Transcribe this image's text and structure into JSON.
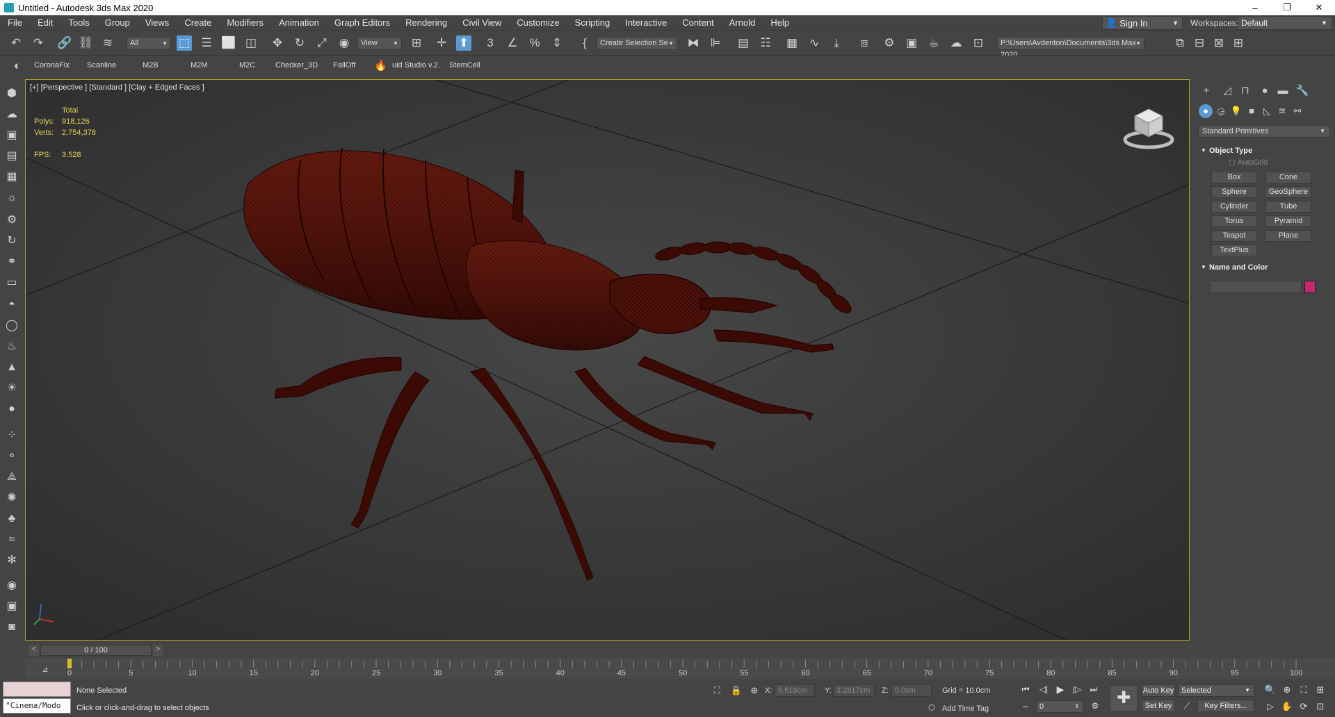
{
  "window": {
    "title": "Untitled - Autodesk 3ds Max 2020",
    "minimize": "–",
    "restore": "❐",
    "close": "✕"
  },
  "menu": [
    "File",
    "Edit",
    "Tools",
    "Group",
    "Views",
    "Create",
    "Modifiers",
    "Animation",
    "Graph Editors",
    "Rendering",
    "Civil View",
    "Customize",
    "Scripting",
    "Interactive",
    "Content",
    "Arnold",
    "Help"
  ],
  "account": {
    "sign_in": "Sign In",
    "workspaces_label": "Workspaces:",
    "workspace": "Default"
  },
  "toolbar": {
    "selection_filter": "All",
    "ref_coord": "View",
    "named_selection": "Create Selection Se",
    "project_path": "P:\\Users\\Avdenton\\Documents\\3ds Max 2020"
  },
  "plugins": [
    "CoronaFix",
    "Scanline",
    "M2B",
    "M2M",
    "M2C",
    "Checker_3D",
    "FallOff",
    "uid Studio v.2.",
    "StemCell"
  ],
  "viewport": {
    "label": "[+] [Perspective ] [Standard ] [Clay + Edged Faces ]",
    "stats": {
      "header": "Total",
      "polys_label": "Polys:",
      "polys": "918,126",
      "verts_label": "Verts:",
      "verts": "2,754,378",
      "fps_label": "FPS:",
      "fps": "3.528"
    }
  },
  "command_panel": {
    "primitive_type": "Standard Primitives",
    "object_type_title": "Object Type",
    "autogrid": "AutoGrid",
    "primitives": [
      "Box",
      "Cone",
      "Sphere",
      "GeoSphere",
      "Cylinder",
      "Tube",
      "Torus",
      "Pyramid",
      "Teapot",
      "Plane",
      "TextPlus"
    ],
    "name_color_title": "Name and Color",
    "object_color": "#c4276f"
  },
  "timeline": {
    "frame": "0 / 100",
    "prev": "<",
    "next": ">",
    "ticks": [
      "0",
      "5",
      "10",
      "15",
      "20",
      "25",
      "30",
      "35",
      "40",
      "45",
      "50",
      "55",
      "60",
      "65",
      "70",
      "75",
      "80",
      "85",
      "90",
      "95",
      "100"
    ]
  },
  "status": {
    "maxscript_input": "\"Cinema/Modo",
    "selection": "None Selected",
    "prompt": "Click or click-and-drag to select objects",
    "x_label": "X:",
    "x": "9.518cm",
    "y_label": "Y:",
    "y": "3.2817cm",
    "z_label": "Z:",
    "z": "0.0cm",
    "grid": "Grid = 10.0cm",
    "add_time_tag": "Add Time Tag",
    "auto_key": "Auto Key",
    "selected": "Selected",
    "set_key": "Set Key",
    "key_filters": "Key Filters...",
    "current_frame": "0"
  }
}
